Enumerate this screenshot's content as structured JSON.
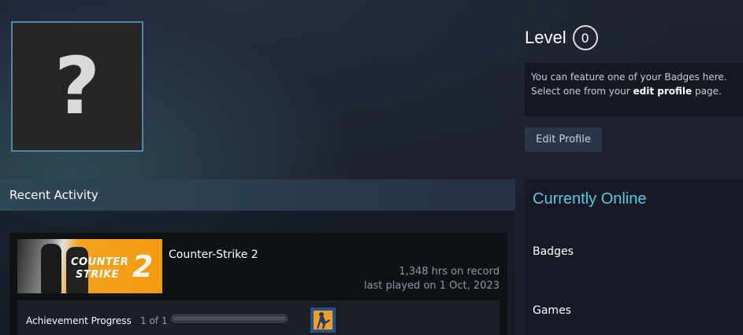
{
  "avatar": {
    "placeholder_glyph": "?",
    "icon": "question-mark-icon"
  },
  "level": {
    "label": "Level",
    "value": "0"
  },
  "badge_note": {
    "line1": "You can feature one of your Badges here.",
    "line2_prefix": "Select one from your ",
    "line2_link": "edit profile",
    "line2_suffix": " page."
  },
  "edit_profile_button": "Edit Profile",
  "recent_activity": {
    "title": "Recent Activity",
    "game": {
      "name": "Counter-Strike 2",
      "hours": "1,348 hrs on record",
      "last_played": "last played on 1 Oct, 2023",
      "capsule_text": [
        "COUNTER",
        "STRIKE",
        "2"
      ],
      "achievement": {
        "label": "Achievement Progress",
        "count": "1 of 1",
        "progress_fraction": 1.0
      }
    }
  },
  "sidebar": {
    "status": "Currently Online",
    "links": [
      "Badges",
      "Games"
    ]
  },
  "colors": {
    "accent_online": "#57cbde",
    "button_bg": "#2a3648",
    "avatar_border": "#4f8aa1"
  }
}
